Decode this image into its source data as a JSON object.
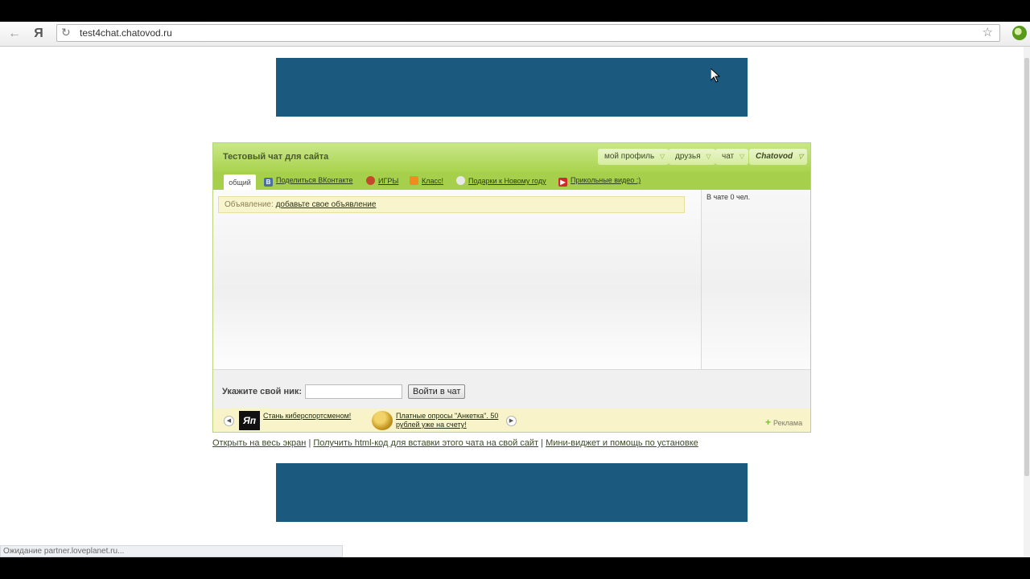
{
  "browser": {
    "url": "test4chat.chatovod.ru",
    "back_icon": "←",
    "yandex_label": "Я",
    "status_text": "Ожидание partner.loveplanet.ru..."
  },
  "chat": {
    "title": "Тестовый чат для сайта",
    "header_menu": {
      "profile": "мой профиль",
      "friends": "друзья",
      "chat": "чат",
      "brand": "Chatovod"
    },
    "tabs": {
      "active": "общий",
      "links": [
        {
          "label": "Поделиться ВКонтакте",
          "icon": "vk-icon"
        },
        {
          "label": "ИГРЫ",
          "icon": "games-icon"
        },
        {
          "label": "Класс!",
          "icon": "odnoklassniki-icon"
        },
        {
          "label": "Подарки к Новому году",
          "icon": "gift-icon"
        },
        {
          "label": "Прикольные видео :)",
          "icon": "youtube-icon"
        }
      ]
    },
    "announcement": {
      "prefix": "Объявление:",
      "link": "добавьте свое объявление"
    },
    "online_count": "В чате 0 чел.",
    "login": {
      "label": "Укажите свой ник:",
      "nick_value": "",
      "button": "Войти в чат"
    },
    "ads": {
      "item1": "Стань киберспортсменом!",
      "item2_line1": "Платные опросы \"Анкетка\". 50",
      "item2_line2": "рублей уже на счету!",
      "reklama": "Реклама"
    }
  },
  "bottom_links": {
    "fullscreen": "Открыть на весь экран",
    "sep": "|",
    "html_code": "Получить html-код для вставки этого чата на свой сайт",
    "widget": "Мини-виджет и помощь по установке"
  },
  "colors": {
    "banner": "#1b5a7e",
    "chat_header": "#a9d34d",
    "announce_bg": "#f8f4cc"
  }
}
